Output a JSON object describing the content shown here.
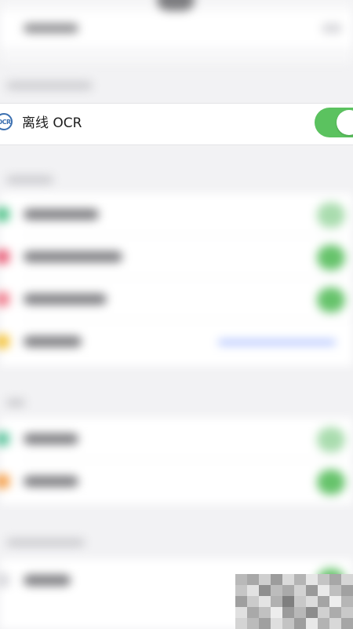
{
  "offline_ocr": {
    "label": "离线 OCR",
    "icon": "ocr-icon",
    "icon_text": "OCR",
    "toggle_on": true,
    "toggle_color": "#5bc25f"
  },
  "background": {
    "color": "#f2f2f4",
    "rows_blurred": true
  }
}
